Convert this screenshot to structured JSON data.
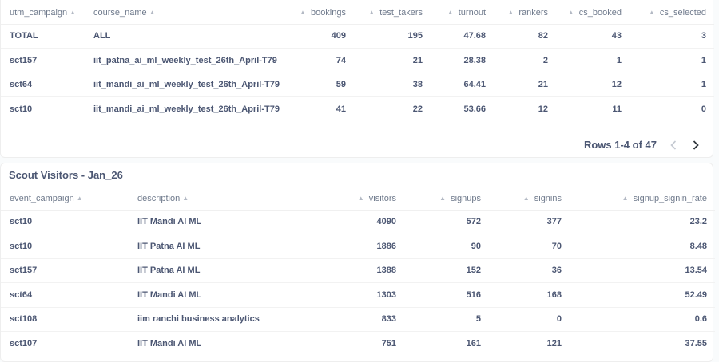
{
  "table1": {
    "columns": [
      {
        "label": "utm_campaign",
        "align": "left"
      },
      {
        "label": "course_name",
        "align": "left"
      },
      {
        "label": "bookings",
        "align": "right"
      },
      {
        "label": "test_takers",
        "align": "right"
      },
      {
        "label": "turnout",
        "align": "right"
      },
      {
        "label": "rankers",
        "align": "right"
      },
      {
        "label": "cs_booked",
        "align": "right"
      },
      {
        "label": "cs_selected",
        "align": "right"
      }
    ],
    "rows": [
      [
        "TOTAL",
        "ALL",
        "409",
        "195",
        "47.68",
        "82",
        "43",
        "3"
      ],
      [
        "sct157",
        "iit_patna_ai_ml_weekly_test_26th_April-T79",
        "74",
        "21",
        "28.38",
        "2",
        "1",
        "1"
      ],
      [
        "sct64",
        "iit_mandi_ai_ml_weekly_test_26th_April-T79",
        "59",
        "38",
        "64.41",
        "21",
        "12",
        "1"
      ],
      [
        "sct10",
        "iit_mandi_ai_ml_weekly_test_26th_April-T79",
        "41",
        "22",
        "53.66",
        "12",
        "11",
        "0"
      ]
    ],
    "pagination": {
      "label": "Rows 1-4 of 47"
    }
  },
  "table2": {
    "title": "Scout Visitors - Jan_26",
    "columns": [
      {
        "label": "event_campaign",
        "align": "left"
      },
      {
        "label": "description",
        "align": "left"
      },
      {
        "label": "visitors",
        "align": "right"
      },
      {
        "label": "signups",
        "align": "right"
      },
      {
        "label": "signins",
        "align": "right"
      },
      {
        "label": "signup_signin_rate",
        "align": "right"
      }
    ],
    "rows": [
      [
        "sct10",
        "IIT Mandi AI ML",
        "4090",
        "572",
        "377",
        "23.2"
      ],
      [
        "sct10",
        "IIT Patna AI ML",
        "1886",
        "90",
        "70",
        "8.48"
      ],
      [
        "sct157",
        "IIT Patna AI ML",
        "1388",
        "152",
        "36",
        "13.54"
      ],
      [
        "sct64",
        "IIT Mandi AI ML",
        "1303",
        "516",
        "168",
        "52.49"
      ],
      [
        "sct108",
        "iim ranchi business analytics",
        "833",
        "5",
        "0",
        "0.6"
      ],
      [
        "sct107",
        "IIT Mandi AI ML",
        "751",
        "161",
        "121",
        "37.55"
      ]
    ]
  },
  "icons": {
    "sort": "sort-up-icon",
    "prev": "chevron-left-icon",
    "next": "chevron-right-icon"
  },
  "colors": {
    "text": "#4c5773",
    "header_text": "#6f7a8c",
    "border": "#f0f0f0",
    "disabled": "#c4c9d1"
  }
}
